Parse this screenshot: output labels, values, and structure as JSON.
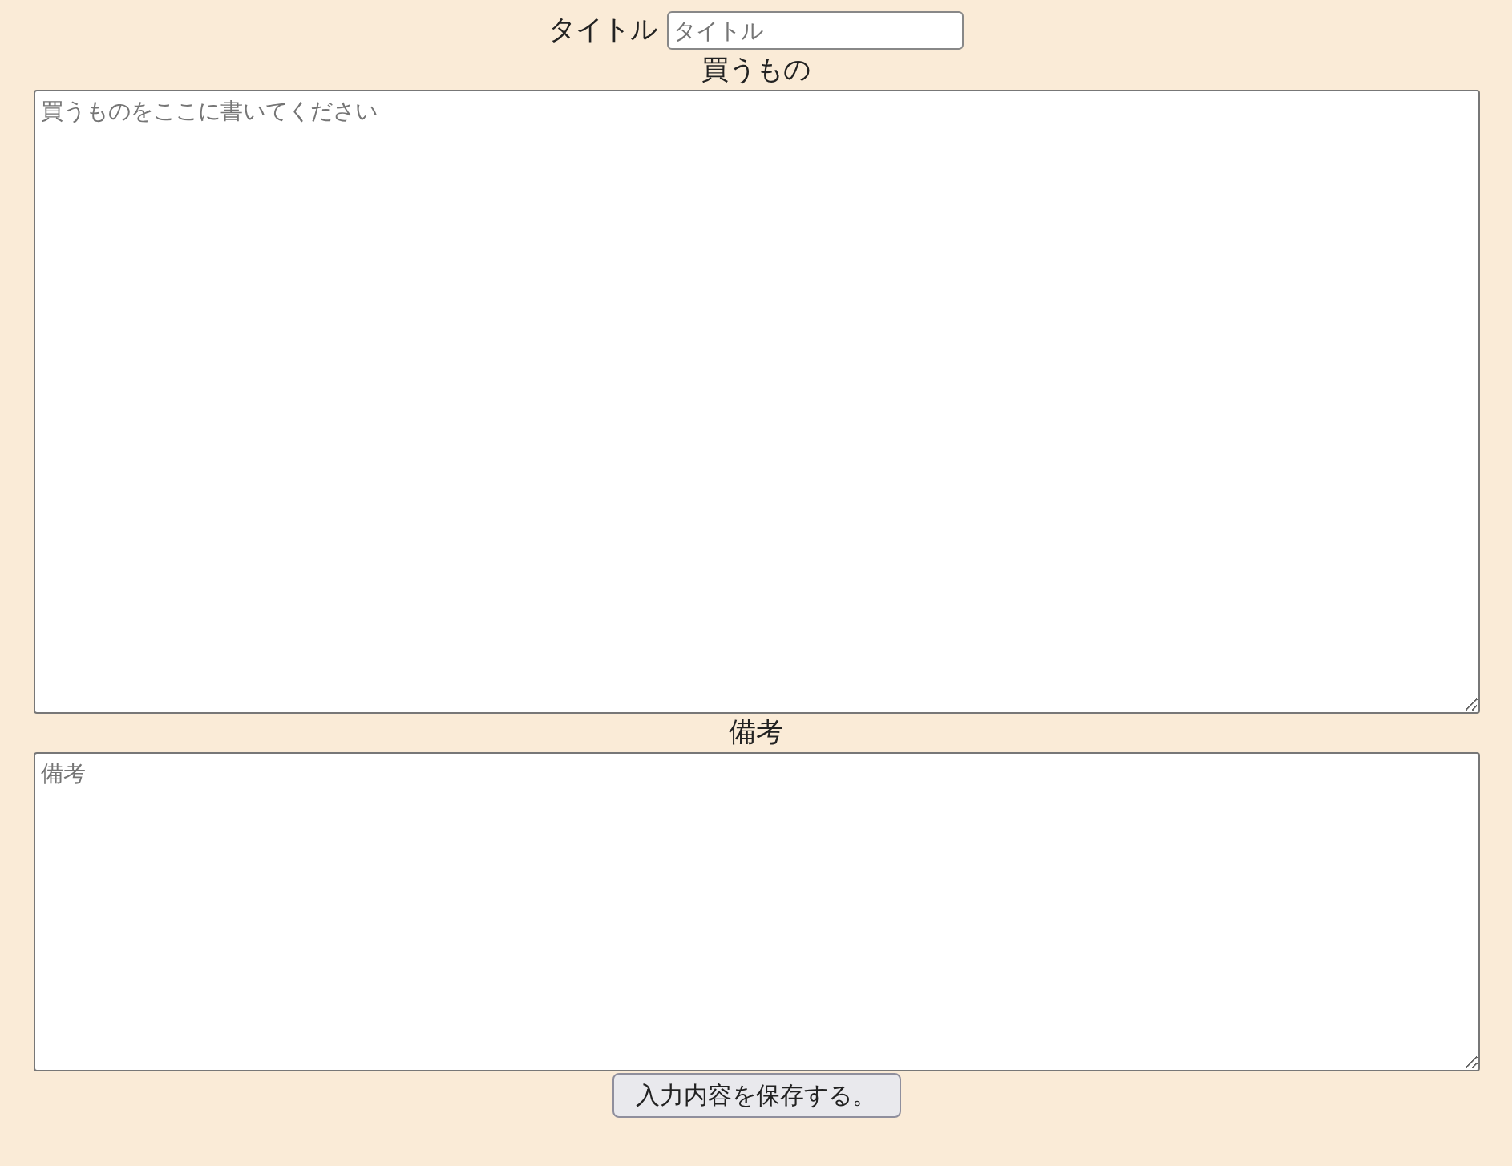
{
  "title_field": {
    "label": "タイトル",
    "placeholder": "タイトル"
  },
  "shopping": {
    "label": "買うもの",
    "placeholder": "買うものをここに書いてください"
  },
  "notes": {
    "label": "備考",
    "placeholder": "備考"
  },
  "save_button": "入力内容を保存する。"
}
